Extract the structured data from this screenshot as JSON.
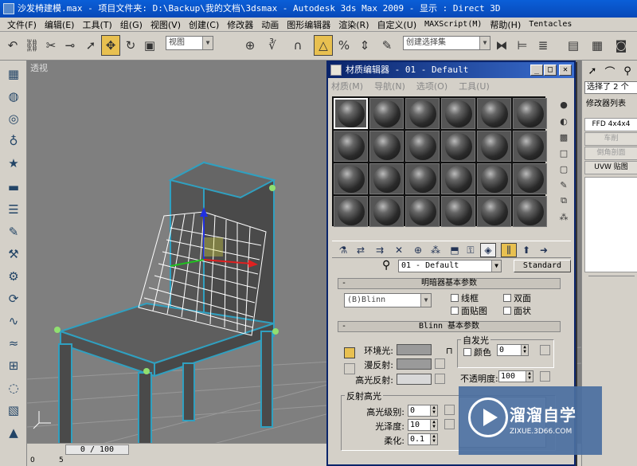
{
  "window": {
    "title": "沙发椅建模.max     - 项目文件夹: D:\\Backup\\我的文档\\3dsmax     - Autodesk 3ds Max  2009     - 显示 : Direct 3D"
  },
  "menu": [
    "文件(F)",
    "编辑(E)",
    "工具(T)",
    "组(G)",
    "视图(V)",
    "创建(C)",
    "修改器",
    "动画",
    "图形编辑器",
    "渲染(R)",
    "自定义(U)",
    "MAXScript(M)",
    "帮助(H)",
    "Tentacles"
  ],
  "toolbar": {
    "view_dropdown": "视图",
    "selection_set": "创建选择集"
  },
  "viewport": {
    "label": "透视"
  },
  "timeline": {
    "slider": "0 / 100",
    "ticks": [
      "0",
      "5"
    ]
  },
  "command_panel": {
    "selection": "选择了 2 个",
    "modifier_list": "修改器列表",
    "stack": [
      "FFD 4x4x4",
      "车削",
      "倒角剖面",
      "UVW 贴图"
    ]
  },
  "material_editor": {
    "title": "材质编辑器 - 01 - Default",
    "menu": [
      "材质(M)",
      "导航(N)",
      "选项(O)",
      "工具(U)"
    ],
    "material_name": "01 - Default",
    "material_type": "Standard",
    "shader_rollout": {
      "title": "明暗器基本参数",
      "shader": "(B)Blinn",
      "options": [
        "线框",
        "双面",
        "面贴图",
        "面状"
      ]
    },
    "blinn_rollout": {
      "title": "Blinn 基本参数",
      "self_illum_group": "自发光",
      "color_label": "颜色",
      "color_value": "0",
      "ambient": "环境光:",
      "diffuse": "漫反射:",
      "specular": "高光反射:",
      "opacity_label": "不透明度:",
      "opacity_value": "100"
    },
    "specular_group": {
      "title": "反射高光",
      "level_label": "高光级别:",
      "level_value": "0",
      "gloss_label": "光泽度:",
      "gloss_value": "10",
      "soften_label": "柔化:",
      "soften_value": "0.1"
    }
  },
  "watermark": {
    "title": "溜溜自学",
    "url": "ZIXUE.3D66.COM"
  }
}
